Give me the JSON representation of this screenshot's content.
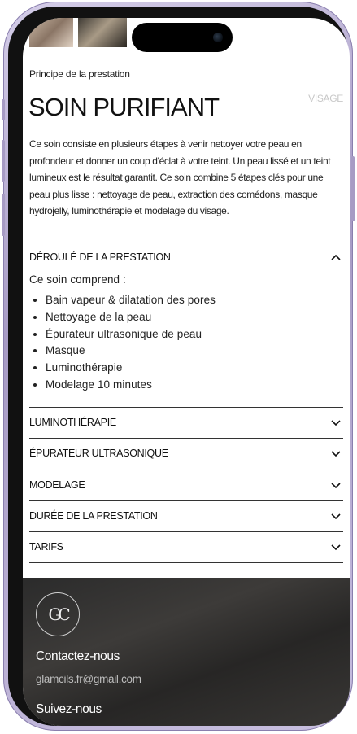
{
  "hero": {
    "kicker": "Principe de la prestation",
    "title": "SOIN PURIFIANT",
    "category": "VISAGE",
    "description": "Ce soin consiste en plusieurs étapes à venir nettoyer votre peau en profondeur et donner un coup d'éclat à votre teint. Un peau lissé et un teint lumineux est le résultat garantit. Ce soin combine 5 étapes clés pour une peau plus lisse : nettoyage de peau, extraction des comédons, masque hydrojelly, luminothérapie et modelage du visage."
  },
  "accordion": {
    "open_section": {
      "label": "DÉROULÉ DE LA PRESTATION",
      "intro": "Ce soin comprend :",
      "items": [
        "Bain vapeur & dilatation des pores",
        "Nettoyage de la peau",
        "Épurateur ultrasonique de peau",
        "Masque",
        "Luminothérapie",
        "Modelage 10 minutes"
      ]
    },
    "sections": [
      "LUMINOTHÉRAPIE",
      "ÉPURATEUR ULTRASONIQUE",
      "MODELAGE",
      "DURÉE DE LA PRESTATION",
      "TARIFS"
    ]
  },
  "footer": {
    "logo_text": "GC",
    "contact_title": "Contactez-nous",
    "email": "glamcils.fr@gmail.com",
    "follow_title": "Suivez-nous"
  },
  "icons": {
    "open": "chevron-up-icon",
    "closed": "chevron-down-icon"
  }
}
